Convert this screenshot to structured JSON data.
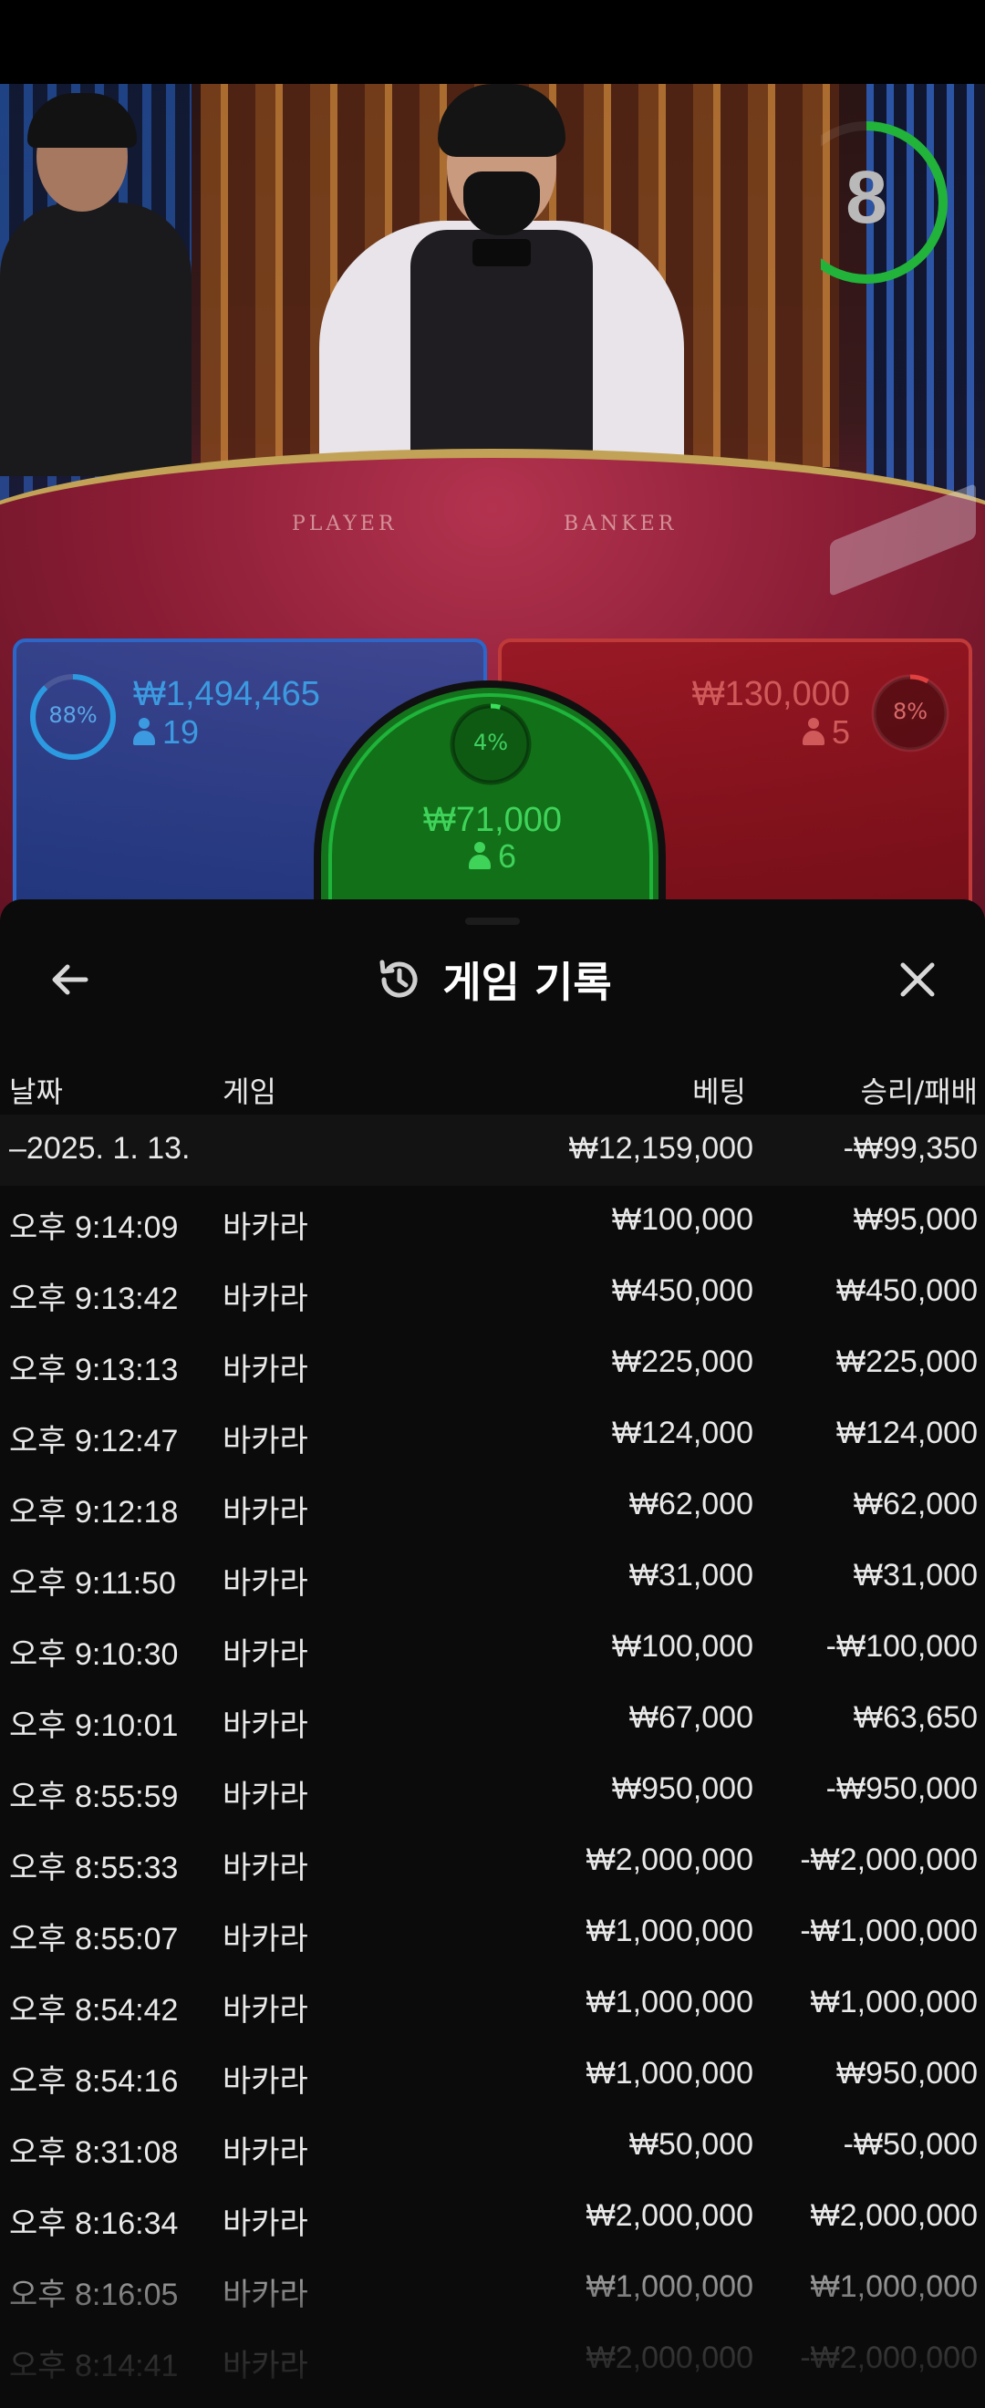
{
  "timer": {
    "value": "8",
    "progress": 0.62,
    "color": "#22b33a"
  },
  "table_text": {
    "player": "PLAYER",
    "banker": "BANKER"
  },
  "bets": {
    "player": {
      "percent": "88%",
      "percent_value": 0.88,
      "amount": "₩1,494,465",
      "players": "19",
      "color": "#2c66c8"
    },
    "tie": {
      "percent": "4%",
      "percent_value": 0.04,
      "amount": "₩71,000",
      "players": "6",
      "color": "#1fb43a"
    },
    "banker": {
      "percent": "8%",
      "percent_value": 0.08,
      "amount": "₩130,000",
      "players": "5",
      "color": "#c03a3a"
    }
  },
  "sheet": {
    "title": "게임 기록",
    "icons": {
      "back": "arrow-left-icon",
      "history": "history-icon",
      "close": "close-icon"
    },
    "columns": {
      "date": "날짜",
      "game": "게임",
      "bet": "베팅",
      "result": "승리/패배"
    },
    "date_row": {
      "date": "–2025. 1. 13.",
      "bet": "₩12,159,000",
      "result": "-₩99,350"
    },
    "rows": [
      {
        "time": "오후 9:14:09",
        "game": "바카라",
        "bet": "₩100,000",
        "result": "₩95,000"
      },
      {
        "time": "오후 9:13:42",
        "game": "바카라",
        "bet": "₩450,000",
        "result": "₩450,000"
      },
      {
        "time": "오후 9:13:13",
        "game": "바카라",
        "bet": "₩225,000",
        "result": "₩225,000"
      },
      {
        "time": "오후 9:12:47",
        "game": "바카라",
        "bet": "₩124,000",
        "result": "₩124,000"
      },
      {
        "time": "오후 9:12:18",
        "game": "바카라",
        "bet": "₩62,000",
        "result": "₩62,000"
      },
      {
        "time": "오후 9:11:50",
        "game": "바카라",
        "bet": "₩31,000",
        "result": "₩31,000"
      },
      {
        "time": "오후 9:10:30",
        "game": "바카라",
        "bet": "₩100,000",
        "result": "-₩100,000"
      },
      {
        "time": "오후 9:10:01",
        "game": "바카라",
        "bet": "₩67,000",
        "result": "₩63,650"
      },
      {
        "time": "오후 8:55:59",
        "game": "바카라",
        "bet": "₩950,000",
        "result": "-₩950,000"
      },
      {
        "time": "오후 8:55:33",
        "game": "바카라",
        "bet": "₩2,000,000",
        "result": "-₩2,000,000"
      },
      {
        "time": "오후 8:55:07",
        "game": "바카라",
        "bet": "₩1,000,000",
        "result": "-₩1,000,000"
      },
      {
        "time": "오후 8:54:42",
        "game": "바카라",
        "bet": "₩1,000,000",
        "result": "₩1,000,000"
      },
      {
        "time": "오후 8:54:16",
        "game": "바카라",
        "bet": "₩1,000,000",
        "result": "₩950,000"
      },
      {
        "time": "오후 8:31:08",
        "game": "바카라",
        "bet": "₩50,000",
        "result": "-₩50,000"
      },
      {
        "time": "오후 8:16:34",
        "game": "바카라",
        "bet": "₩2,000,000",
        "result": "₩2,000,000"
      },
      {
        "time": "오후 8:16:05",
        "game": "바카라",
        "bet": "₩1,000,000",
        "result": "₩1,000,000"
      },
      {
        "time": "오후 8:14:41",
        "game": "바카라",
        "bet": "₩2,000,000",
        "result": "-₩2,000,000"
      }
    ]
  }
}
